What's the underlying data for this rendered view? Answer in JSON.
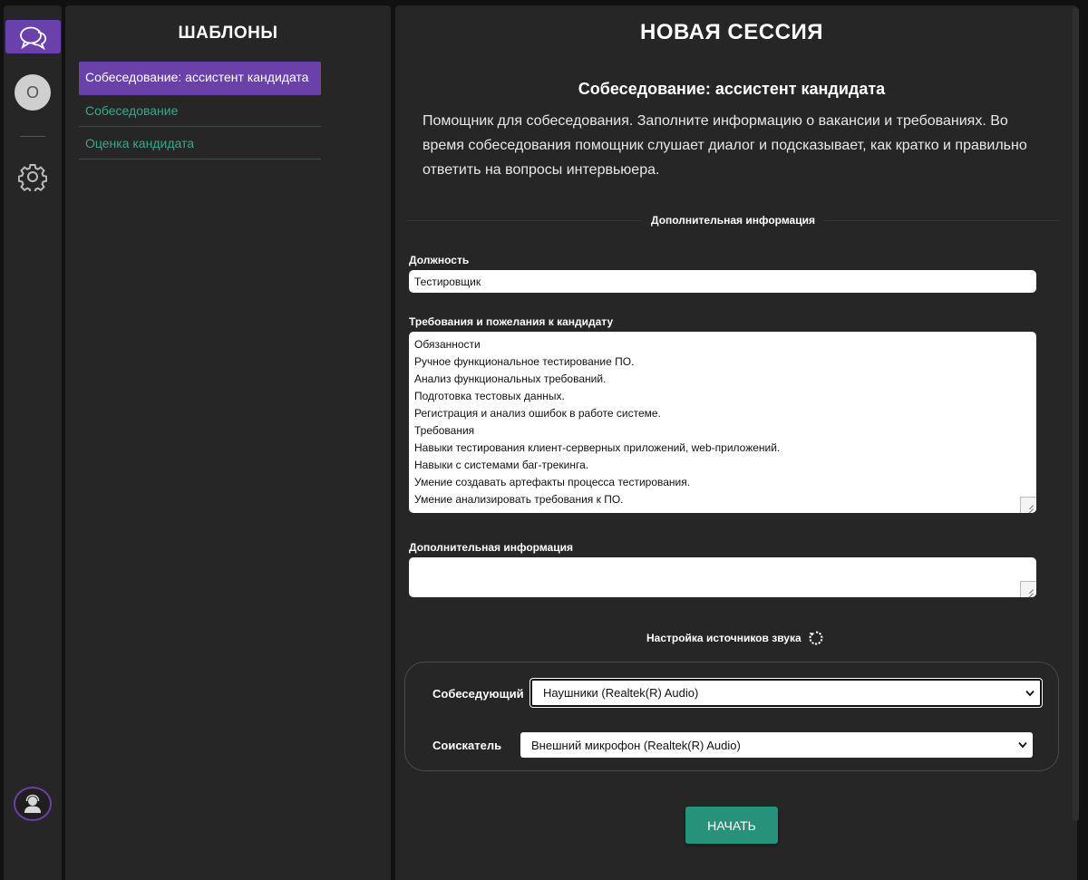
{
  "rail": {
    "avatar_letter": "O"
  },
  "templates": {
    "title": "ШАБЛОНЫ",
    "items": [
      {
        "label": "Собеседование: ассистент кандидата",
        "active": true
      },
      {
        "label": "Собеседование",
        "active": false
      },
      {
        "label": "Оценка кандидата",
        "active": false
      }
    ]
  },
  "session": {
    "title": "НОВАЯ СЕССИЯ",
    "name": "Собеседование: ассистент кандидата",
    "description": "Помощник для собеседования. Заполните информацию о вакансии и требованиях. Во время собеседования помощник слушает диалог и подсказывает, как кратко и правильно ответить на вопросы интервьюера.",
    "extra_section_label": "Дополнительная информация",
    "position_label": "Должность",
    "position_value": "Тестировщик",
    "requirements_label": "Требования и пожелания к кандидату",
    "requirements_lines": [
      "Обязанности",
      "Ручное функциональное тестирование ПО.",
      "Анализ функциональных требований.",
      "Подготовка тестовых данных.",
      "Регистрация и анализ ошибок в работе системе.",
      "Требования",
      "Навыки тестирования клиент-серверных приложений, web-приложений.",
      "Навыки с системами баг-трекинга.",
      "Умение создавать артефакты процесса тестирования.",
      "Умение анализировать требования к ПО."
    ],
    "additional_label": "Дополнительная информация",
    "additional_value": "",
    "audio_section_label": "Настройка источников звука",
    "interviewer_label": "Собеседующий",
    "interviewer_device": "Наушники (Realtek(R) Audio)",
    "candidate_label": "Соискатель",
    "candidate_device": "Внешний микрофон (Realtek(R) Audio)",
    "start_label": "НАЧАТЬ"
  },
  "colors": {
    "accent": "#6a41a8",
    "link": "#3fa58a",
    "start_button": "#27917a",
    "panel": "#262626",
    "background": "#111111"
  }
}
